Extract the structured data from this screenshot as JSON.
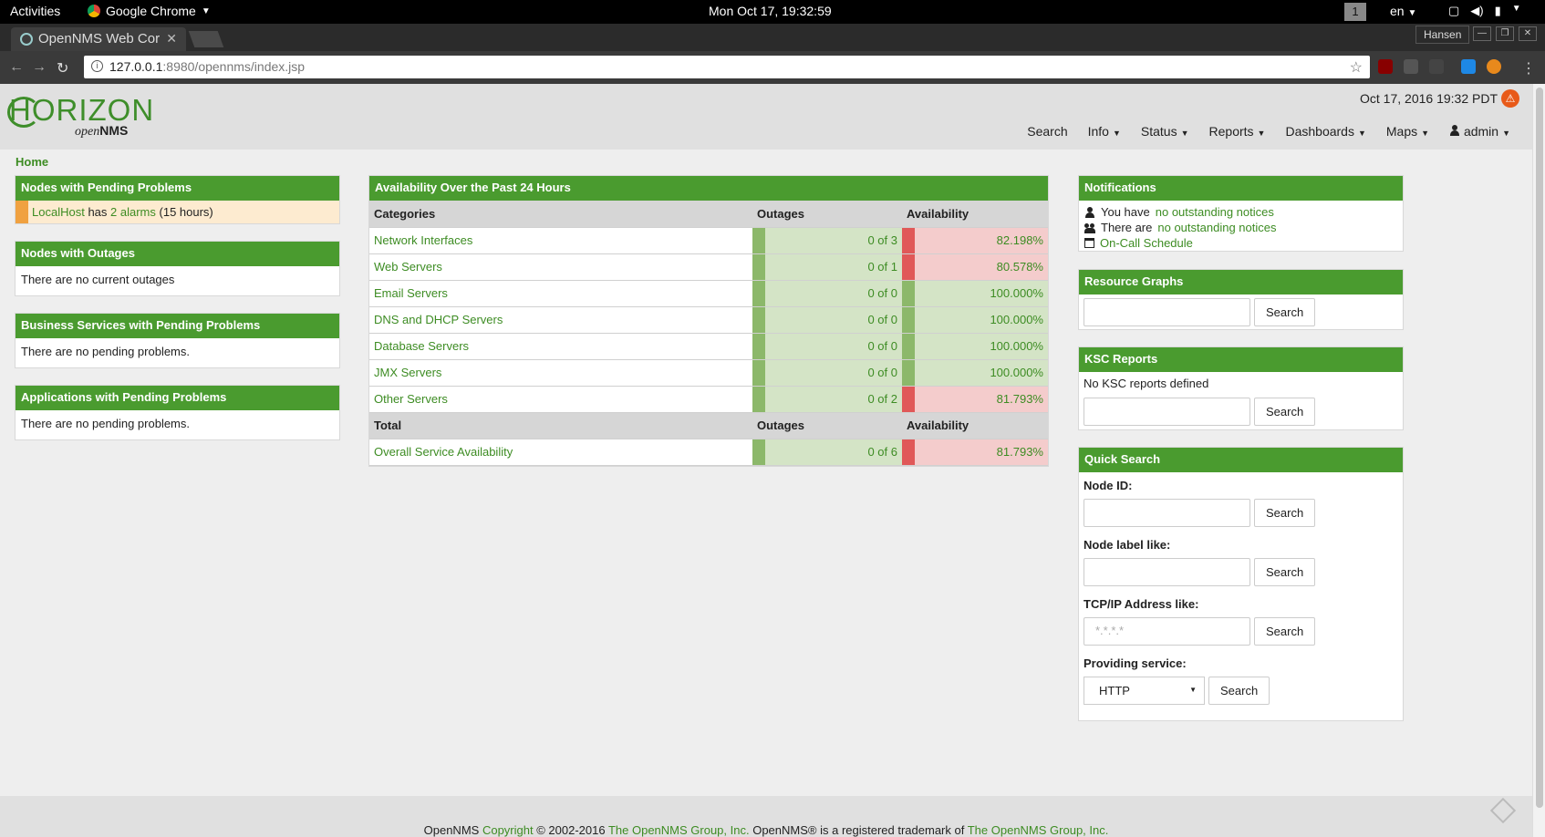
{
  "gnome": {
    "activities": "Activities",
    "app": "Google Chrome",
    "clock": "Mon Oct 17, 19:32:59",
    "workspace": "1",
    "lang": "en"
  },
  "browser": {
    "tab_title": "OpenNMS Web Cor",
    "profile": "Hansen",
    "url_host": "127.0.0.1",
    "url_path": ":8980/opennms/index.jsp"
  },
  "header": {
    "logo_main": "HORIZON",
    "logo_sub_italic": "open",
    "logo_sub_bold": "NMS",
    "datetime": "Oct 17, 2016 19:32 PDT",
    "nav": {
      "search": "Search",
      "info": "Info",
      "status": "Status",
      "reports": "Reports",
      "dashboards": "Dashboards",
      "maps": "Maps",
      "user": "admin"
    }
  },
  "breadcrumb": "Home",
  "left": {
    "pending": {
      "title": "Nodes with Pending Problems",
      "node": "LocalHost",
      "has": "has",
      "alarms": "2 alarms",
      "duration": "(15 hours)"
    },
    "outages": {
      "title": "Nodes with Outages",
      "text": "There are no current outages"
    },
    "business": {
      "title": "Business Services with Pending Problems",
      "text": "There are no pending problems."
    },
    "applications": {
      "title": "Applications with Pending Problems",
      "text": "There are no pending problems."
    }
  },
  "availability": {
    "title": "Availability Over the Past 24 Hours",
    "headers": {
      "categories": "Categories",
      "outages": "Outages",
      "availability": "Availability"
    },
    "rows": [
      {
        "name": "Network Interfaces",
        "outages": "0 of 3",
        "availability": "82.198%",
        "status": "red"
      },
      {
        "name": "Web Servers",
        "outages": "0 of 1",
        "availability": "80.578%",
        "status": "red"
      },
      {
        "name": "Email Servers",
        "outages": "0 of 0",
        "availability": "100.000%",
        "status": "green"
      },
      {
        "name": "DNS and DHCP Servers",
        "outages": "0 of 0",
        "availability": "100.000%",
        "status": "green"
      },
      {
        "name": "Database Servers",
        "outages": "0 of 0",
        "availability": "100.000%",
        "status": "green"
      },
      {
        "name": "JMX Servers",
        "outages": "0 of 0",
        "availability": "100.000%",
        "status": "green"
      },
      {
        "name": "Other Servers",
        "outages": "0 of 2",
        "availability": "81.793%",
        "status": "red"
      }
    ],
    "total_headers": {
      "total": "Total",
      "outages": "Outages",
      "availability": "Availability"
    },
    "total": {
      "name": "Overall Service Availability",
      "outages": "0 of 6",
      "availability": "81.793%",
      "status": "red"
    }
  },
  "right": {
    "notifications": {
      "title": "Notifications",
      "line1_prefix": "You have",
      "line1_link": "no outstanding notices",
      "line2_prefix": "There are",
      "line2_link": "no outstanding notices",
      "line3_link": "On-Call Schedule"
    },
    "resource_graphs": {
      "title": "Resource Graphs",
      "button": "Search"
    },
    "ksc": {
      "title": "KSC Reports",
      "text": "No KSC reports defined",
      "button": "Search"
    },
    "quick_search": {
      "title": "Quick Search",
      "node_id_label": "Node ID:",
      "node_label_label": "Node label like:",
      "ip_label": "TCP/IP Address like:",
      "ip_placeholder": "*.*.*.*",
      "service_label": "Providing service:",
      "service_selected": "HTTP",
      "button": "Search"
    }
  },
  "footer": {
    "prefix": "OpenNMS",
    "copyright": "Copyright",
    "years": "© 2002-2016",
    "group1": "The OpenNMS Group, Inc.",
    "trademark": "OpenNMS® is a registered trademark of",
    "group2": "The OpenNMS Group, Inc."
  },
  "colors": {
    "brand_green": "#4a9b2f",
    "link_green": "#3d8c23",
    "status_red": "#e05858",
    "status_green": "#8cb86a"
  }
}
